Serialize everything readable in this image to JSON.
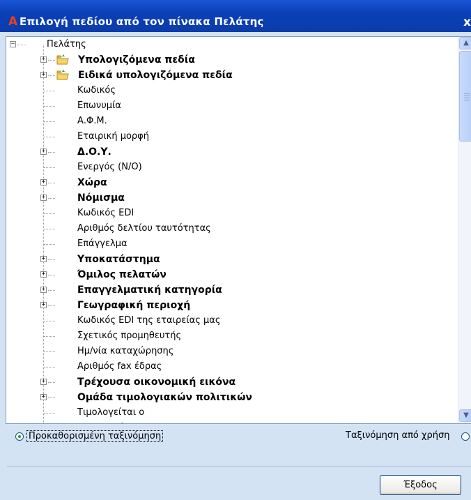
{
  "window": {
    "title": "Επιλογή πεδίου από τον πίνακα Πελάτης",
    "icon": "app-logo-icon",
    "close_label": "x"
  },
  "tree": {
    "root_label": "Πελάτης",
    "items": [
      {
        "label": "Υπολογιζόμενα πεδία",
        "bold": true,
        "expandable": true,
        "folder": true
      },
      {
        "label": "Ειδικά υπολογιζόμενα πεδία",
        "bold": true,
        "expandable": true,
        "folder": true
      },
      {
        "label": "Κωδικός",
        "bold": false,
        "expandable": false
      },
      {
        "label": "Επωνυμία",
        "bold": false,
        "expandable": false
      },
      {
        "label": "Α.Φ.Μ.",
        "bold": false,
        "expandable": false
      },
      {
        "label": "Εταιρική μορφή",
        "bold": false,
        "expandable": false
      },
      {
        "label": "Δ.Ο.Υ.",
        "bold": true,
        "expandable": true
      },
      {
        "label": "Ενεργός (Ν/Ο)",
        "bold": false,
        "expandable": false
      },
      {
        "label": "Χώρα",
        "bold": true,
        "expandable": true
      },
      {
        "label": "Νόμισμα",
        "bold": true,
        "expandable": true
      },
      {
        "label": "Κωδικός EDI",
        "bold": false,
        "expandable": false
      },
      {
        "label": "Αριθμός δελτίου ταυτότητας",
        "bold": false,
        "expandable": false
      },
      {
        "label": "Επάγγελμα",
        "bold": false,
        "expandable": false
      },
      {
        "label": "Υποκατάστημα",
        "bold": true,
        "expandable": true
      },
      {
        "label": "Όμιλος πελατών",
        "bold": true,
        "expandable": true
      },
      {
        "label": "Επαγγελματική κατηγορία",
        "bold": true,
        "expandable": true
      },
      {
        "label": "Γεωγραφική περιοχή",
        "bold": true,
        "expandable": true
      },
      {
        "label": "Κωδικός EDI της εταιρείας μας",
        "bold": false,
        "expandable": false
      },
      {
        "label": "Σχετικός προμηθευτής",
        "bold": false,
        "expandable": false
      },
      {
        "label": "Ημ/νία καταχώρησης",
        "bold": false,
        "expandable": false
      },
      {
        "label": "Αριθμός fax έδρας",
        "bold": false,
        "expandable": false
      },
      {
        "label": "Τρέχουσα οικονομική εικόνα",
        "bold": true,
        "expandable": true
      },
      {
        "label": "Ομάδα τιμολογιακών πολιτικών",
        "bold": true,
        "expandable": true
      },
      {
        "label": "Τιμολογείται ο",
        "bold": false,
        "expandable": false
      },
      {
        "label": "Μεταφορέας",
        "bold": false,
        "expandable": false
      }
    ]
  },
  "sort": {
    "default_label": "Προκαθορισμένη ταξινόμηση",
    "default_selected": true,
    "usage_label": "Ταξινόμηση από χρήση",
    "usage_selected": false
  },
  "buttons": {
    "exit_label": "Έξοδος"
  }
}
